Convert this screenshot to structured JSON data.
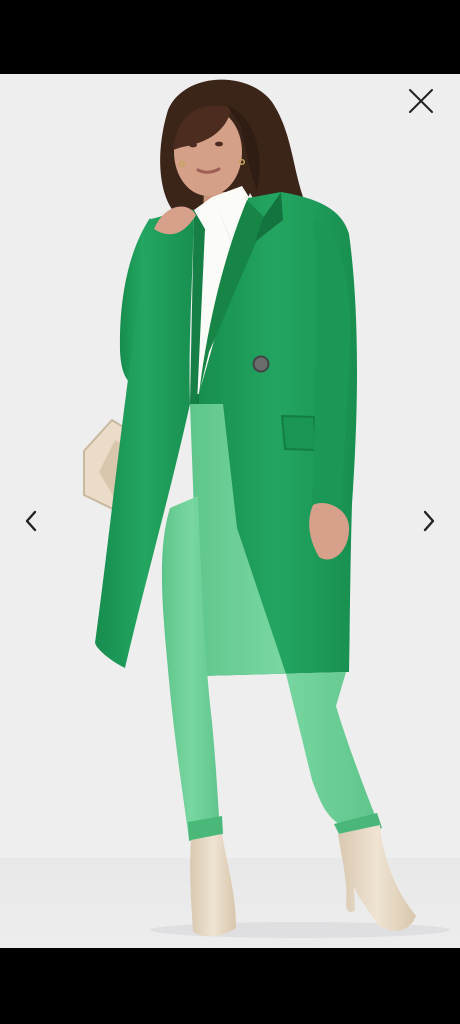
{
  "viewer": {
    "image_icon": "product-photo",
    "close_icon": "close-icon",
    "prev_icon": "chevron-left-icon",
    "next_icon": "chevron-right-icon"
  },
  "colors": {
    "background": "#eeeeef",
    "coat": "#1f9f5a",
    "trousers": "#6fd09a",
    "boots": "#eadcc8",
    "icon": "#222222"
  }
}
